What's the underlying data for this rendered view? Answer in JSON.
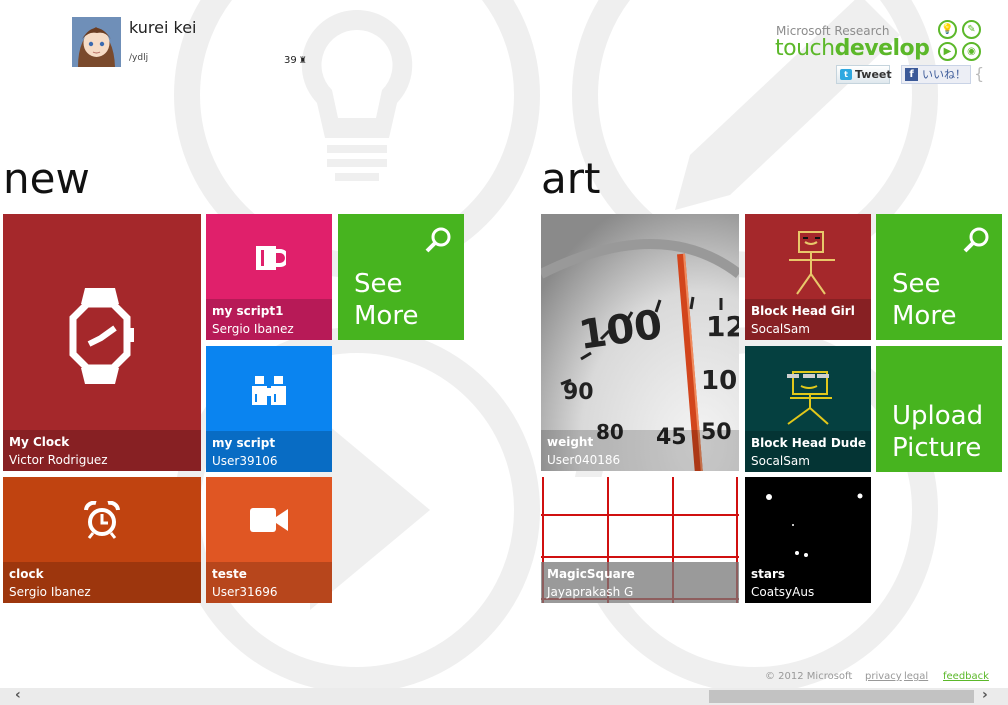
{
  "profile": {
    "name": "kurei kei",
    "handle": "/ydlj",
    "score": "39"
  },
  "brand": {
    "top": "Microsoft Research",
    "light": "touch",
    "bold": "develop",
    "color": "#5cb82a"
  },
  "social": {
    "tweet_label": "Tweet",
    "like_label": "いいね！"
  },
  "sections": {
    "new_title": "new",
    "art_title": "art"
  },
  "tiles_new": [
    {
      "title": "My Clock",
      "author": "Victor Rodriguez",
      "color": "#a5282b",
      "icon": "watch-icon"
    },
    {
      "title": "my script1",
      "author": "Sergio Ibanez",
      "color": "#e0206b",
      "icon": "mug-icon"
    },
    {
      "title": "my script",
      "author": "User39106",
      "color": "#0a84f0",
      "icon": "binoculars-icon"
    },
    {
      "title": "clock",
      "author": "Sergio Ibanez",
      "color": "#c04310",
      "icon": "alarm-clock-icon"
    },
    {
      "title": "teste",
      "author": "User31696",
      "color": "#e05623",
      "icon": "video-camera-icon"
    }
  ],
  "tiles_art": [
    {
      "title": "weight",
      "author": "User040186",
      "color": "#d8d8d8",
      "icon": "scale-photo"
    },
    {
      "title": "Block Head Girl",
      "author": "SocalSam",
      "color": "#a5282b",
      "icon": "stick-figure-girl"
    },
    {
      "title": "Block Head Dude",
      "author": "SocalSam",
      "color": "#054040",
      "icon": "stick-figure-dude"
    },
    {
      "title": "MagicSquare",
      "author": "Jayaprakash G",
      "color": "#ffffff",
      "icon": "red-grid"
    },
    {
      "title": "stars",
      "author": "CoatsyAus",
      "color": "#000000",
      "icon": "stars"
    }
  ],
  "see_more": {
    "line1": "See",
    "line2": "More",
    "color": "#47b41f"
  },
  "upload": {
    "line1": "Upload",
    "line2": "Picture",
    "color": "#47b41f"
  },
  "footer": {
    "copyright": "© 2012 Microsoft",
    "privacy": "privacy",
    "legal": "legal",
    "feedback": "feedback"
  }
}
